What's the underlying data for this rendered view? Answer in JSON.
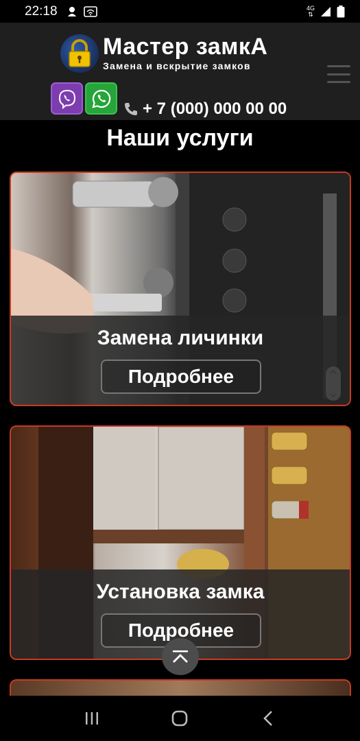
{
  "status_bar": {
    "time": "22:18",
    "network": "4G"
  },
  "header": {
    "brand_title": "Мастер замкА",
    "brand_subtitle": "Замена и вскрытие замков",
    "phone": "+ 7 (000) 000 00 00"
  },
  "main": {
    "title": "Наши услуги",
    "cards": [
      {
        "title": "Замена личинки",
        "button": "Подробнее"
      },
      {
        "title": "Установка замка",
        "button": "Подробнее"
      }
    ]
  },
  "colors": {
    "card_border": "#c73a22",
    "viber": "#7d3daf",
    "whatsapp": "#25a53a",
    "header_bg": "#1f1f1f"
  },
  "icons": [
    "padlock-logo-icon",
    "viber-icon",
    "whatsapp-icon",
    "phone-icon",
    "hamburger-menu-icon",
    "chevron-up-icon",
    "recents-icon",
    "home-icon",
    "back-icon"
  ]
}
